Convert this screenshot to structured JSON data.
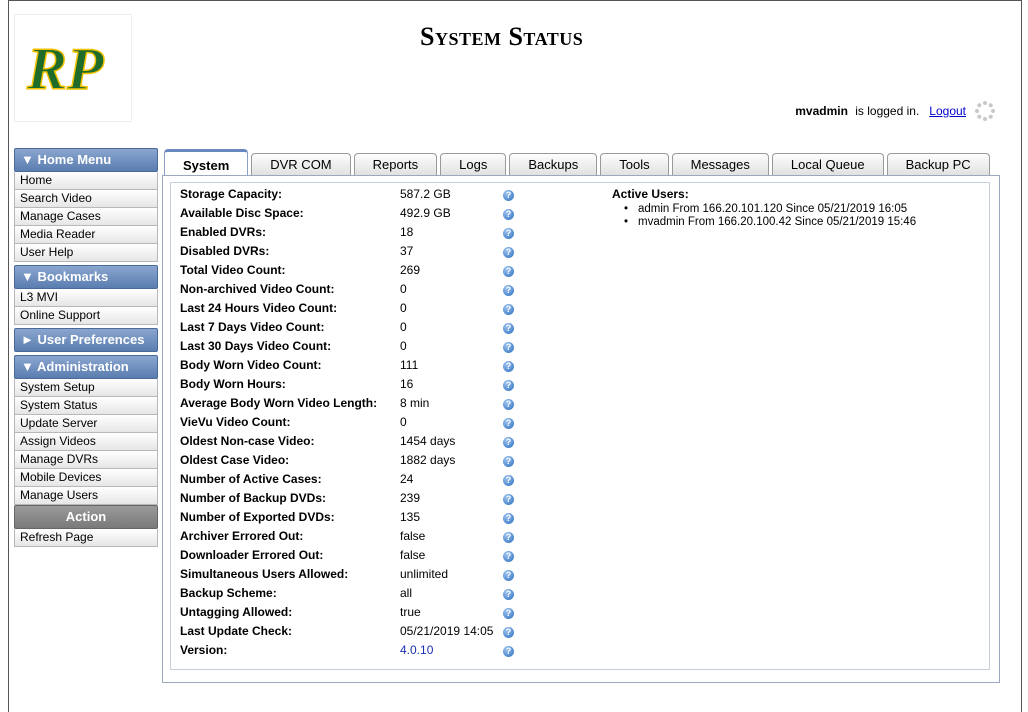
{
  "header": {
    "title": "System Status",
    "logo_text": "RP",
    "user": "mvadmin",
    "logged_in_text": " is logged in.",
    "logout_label": "Logout"
  },
  "sidebar": {
    "home_menu": {
      "title": "▼ Home Menu",
      "items": [
        "Home",
        "Search Video",
        "Manage Cases",
        "Media Reader",
        "User Help"
      ]
    },
    "bookmarks": {
      "title": "▼ Bookmarks",
      "items": [
        "L3 MVI",
        "Online Support"
      ]
    },
    "user_preferences": {
      "title": "► User Preferences"
    },
    "administration": {
      "title": "▼ Administration",
      "items": [
        "System Setup",
        "System Status",
        "Update Server",
        "Assign Videos",
        "Manage DVRs",
        "Mobile Devices",
        "Manage Users"
      ]
    },
    "action": {
      "title": "Action",
      "items": [
        "Refresh Page"
      ]
    }
  },
  "tabs": [
    "System",
    "DVR COM",
    "Reports",
    "Logs",
    "Backups",
    "Tools",
    "Messages",
    "Local Queue",
    "Backup PC"
  ],
  "stats": [
    {
      "label": "Storage Capacity:",
      "value": "587.2 GB"
    },
    {
      "label": "Available Disc Space:",
      "value": "492.9 GB"
    },
    {
      "label": "Enabled DVRs:",
      "value": "18"
    },
    {
      "label": "Disabled DVRs:",
      "value": "37"
    },
    {
      "label": "Total Video Count:",
      "value": "269"
    },
    {
      "label": "Non-archived Video Count:",
      "value": "0"
    },
    {
      "label": "Last 24 Hours Video Count:",
      "value": "0"
    },
    {
      "label": "Last 7 Days Video Count:",
      "value": "0"
    },
    {
      "label": "Last 30 Days Video Count:",
      "value": "0"
    },
    {
      "label": "Body Worn Video Count:",
      "value": "111"
    },
    {
      "label": "Body Worn Hours:",
      "value": "16"
    },
    {
      "label": "Average Body Worn Video Length:",
      "value": "8 min"
    },
    {
      "label": "VieVu Video Count:",
      "value": "0"
    },
    {
      "label": "Oldest Non-case Video:",
      "value": "1454 days"
    },
    {
      "label": "Oldest Case Video:",
      "value": "1882 days"
    },
    {
      "label": "Number of Active Cases:",
      "value": "24"
    },
    {
      "label": "Number of Backup DVDs:",
      "value": "239"
    },
    {
      "label": "Number of Exported DVDs:",
      "value": "135"
    },
    {
      "label": "Archiver Errored Out:",
      "value": "false"
    },
    {
      "label": "Downloader Errored Out:",
      "value": "false"
    },
    {
      "label": "Simultaneous Users Allowed:",
      "value": "unlimited"
    },
    {
      "label": "Backup Scheme:",
      "value": "all"
    },
    {
      "label": "Untagging Allowed:",
      "value": "true"
    },
    {
      "label": "Last Update Check:",
      "value": "05/21/2019 14:05"
    },
    {
      "label": "Version:",
      "value": "4.0.10"
    }
  ],
  "active_users": {
    "title": "Active Users:",
    "users": [
      "admin From 166.20.101.120 Since 05/21/2019 16:05",
      "mvadmin From 166.20.100.42 Since 05/21/2019 15:46"
    ]
  },
  "colors": {
    "sidebar_header": "#5a7db0",
    "action_header": "#7a7a7a",
    "link": "#0000cc",
    "version_value": "#1a2fb5",
    "logo_green": "#1f6b2a",
    "logo_yellow": "#f2c200"
  }
}
